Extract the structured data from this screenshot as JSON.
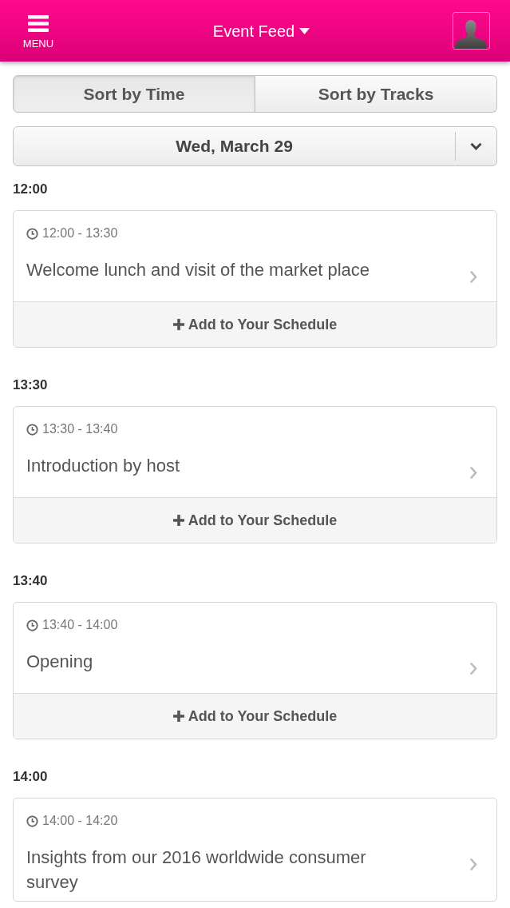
{
  "header": {
    "menu_label": "MENU",
    "title": "Event Feed"
  },
  "sort_tabs": [
    {
      "label": "Sort by Time",
      "selected": true
    },
    {
      "label": "Sort by Tracks",
      "selected": false
    }
  ],
  "date_select": {
    "value": "Wed, March 29"
  },
  "sections": [
    {
      "heading": "12:00",
      "sessions": [
        {
          "time": "12:00 - 13:30",
          "title": "Welcome lunch and visit of the market place",
          "action": "Add to Your Schedule"
        }
      ]
    },
    {
      "heading": "13:30",
      "sessions": [
        {
          "time": "13:30 - 13:40",
          "title": "Introduction by host",
          "action": "Add to Your Schedule"
        }
      ]
    },
    {
      "heading": "13:40",
      "sessions": [
        {
          "time": "13:40 - 14:00",
          "title": "Opening",
          "action": "Add to Your Schedule"
        }
      ]
    },
    {
      "heading": "14:00",
      "sessions": [
        {
          "time": "14:00 - 14:20",
          "title": "Insights from our 2016 worldwide consumer survey"
        }
      ]
    }
  ]
}
